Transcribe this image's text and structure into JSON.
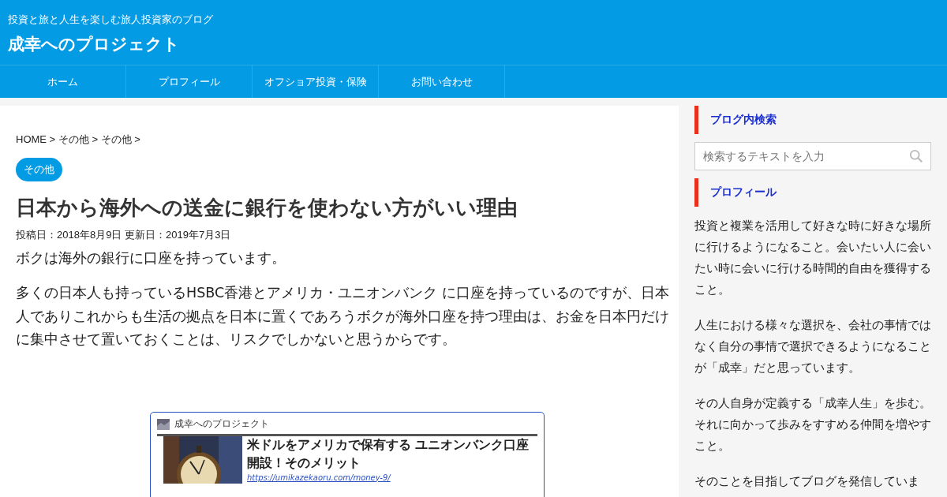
{
  "header": {
    "tagline": "投資と旅と人生を楽しむ旅人投資家のブログ",
    "site_title": "成幸へのプロジェクト"
  },
  "nav": [
    {
      "label": "ホーム"
    },
    {
      "label": "プロフィール"
    },
    {
      "label": "オフショア投資・保険"
    },
    {
      "label": "お問い合わせ"
    }
  ],
  "article": {
    "breadcrumb": "HOME > その他 > その他 >",
    "category": "その他",
    "title": "日本から海外への送金に銀行を使わない方がいい理由",
    "dates": "投稿日：2018年8月9日 更新日：2019年7月3日",
    "paragraphs": [
      "ボクは海外の銀行に口座を持っています。",
      "多くの日本人も持っているHSBC香港とアメリカ・ユニオンバンク に口座を持っているのですが、日本人でありこれからも生活の拠点を日本に置くであろうボクが海外口座を持つ理由は、お金を日本円だけに集中させて置いておくことは、リスクでしかないと思うからです。"
    ],
    "link_card": {
      "site": "成幸へのプロジェクト",
      "title": "米ドルをアメリカで保有する ユニオンバンク口座開設！そのメリット",
      "url": "https://umikazekaoru.com/money-9/"
    }
  },
  "sidebar": {
    "search_heading": "ブログ内検索",
    "search": {
      "placeholder": "検索するテキストを入力"
    },
    "profile_heading": "プロフィール",
    "profile_paragraphs": [
      "投資と複業を活用して好きな時に好きな場所に行けるようになること。会いたい人に会いたい時に会いに行ける時間的自由を獲得すること。",
      "人生における様々な選択を、会社の事情ではなく自分の事情で選択できるようになることが「成幸」だと思っています。",
      "その人自身が定義する「成幸人生」を歩む。それに向かって歩みをすすめる仲間を増やすこと。",
      "そのことを目指してブログを発信していま"
    ]
  }
}
